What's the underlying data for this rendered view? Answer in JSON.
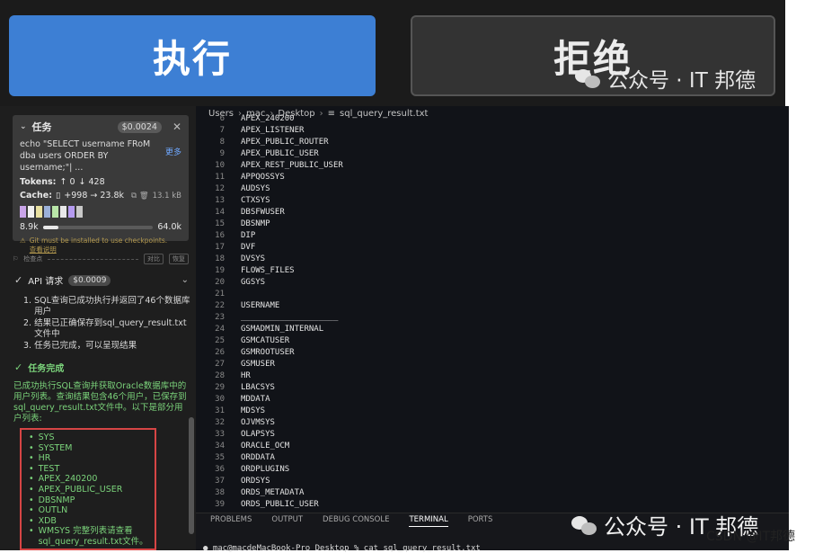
{
  "buttons": {
    "run": "执行",
    "reject": "拒绝"
  },
  "watermark": {
    "text": "公众号 · IT 邦德"
  },
  "credit": "CSDN @IT邦德",
  "task": {
    "label": "任务",
    "cost": "$0.0024",
    "command": "echo \"SELECT username FRoM dba users ORDER BY username;\"| ...",
    "more": "更多",
    "tokens_label": "Tokens:",
    "tokens_up": "↑ 0",
    "tokens_down": "↓ 428",
    "cache_label": "Cache:",
    "cache_value": "+998 → 23.8k",
    "size": "13.1 kB",
    "context_left": "8.9k",
    "context_right": "64.0k",
    "context_fraction": 0.14,
    "warning": "Git must be installed to use checkpoints.",
    "warning_link": "查看说明",
    "swatch_colors": [
      "#c9a4e8",
      "#f0f0f0",
      "#e8e0a0",
      "#9bb0d8",
      "#b9e6a8",
      "#e8e8e8",
      "#b59bf0",
      "#c8c8c8"
    ]
  },
  "mini_bar": {
    "left": "检查点",
    "b1": "对比",
    "b2": "恢复"
  },
  "api": {
    "label": "API 请求",
    "cost": "$0.0009",
    "steps": [
      {
        "n": "1.",
        "text": "SQL查询已成功执行并返回了46个数据库用户"
      },
      {
        "n": "2.",
        "text": "结果已正确保存到sql_query_result.txt文件中"
      },
      {
        "n": "3.",
        "text": "任务已完成，可以呈现结果"
      }
    ]
  },
  "done": {
    "label": "任务完成",
    "summary": "已成功执行SQL查询并获取Oracle数据库中的用户列表。查询结果包含46个用户，已保存到sql_query_result.txt文件中。以下是部分用户列表:"
  },
  "users": [
    "SYS",
    "SYSTEM",
    "HR",
    "TEST",
    "APEX_240200",
    "APEX_PUBLIC_USER",
    "DBSNMP",
    "OUTLN",
    "XDB",
    "WMSYS 完整列表请查看sql_query_result.txt文件。"
  ],
  "breadcrumb": {
    "p1": "Users",
    "p2": "mac",
    "p3": "Desktop",
    "file": "sql_query_result.txt"
  },
  "code_lines": [
    {
      "n": "6",
      "t": "APEX_240200"
    },
    {
      "n": "7",
      "t": "APEX_LISTENER"
    },
    {
      "n": "8",
      "t": "APEX_PUBLIC_ROUTER"
    },
    {
      "n": "9",
      "t": "APEX_PUBLIC_USER"
    },
    {
      "n": "10",
      "t": "APEX_REST_PUBLIC_USER"
    },
    {
      "n": "11",
      "t": "APPQOSSYS"
    },
    {
      "n": "12",
      "t": "AUDSYS"
    },
    {
      "n": "13",
      "t": "CTXSYS"
    },
    {
      "n": "14",
      "t": "DBSFWUSER"
    },
    {
      "n": "15",
      "t": "DBSNMP"
    },
    {
      "n": "16",
      "t": "DIP"
    },
    {
      "n": "17",
      "t": "DVF"
    },
    {
      "n": "18",
      "t": "DVSYS"
    },
    {
      "n": "19",
      "t": "FLOWS_FILES"
    },
    {
      "n": "20",
      "t": "GGSYS"
    },
    {
      "n": "21",
      "t": ""
    },
    {
      "n": "22",
      "t": "USERNAME"
    },
    {
      "n": "23",
      "t": "____________________"
    },
    {
      "n": "24",
      "t": "GSMADMIN_INTERNAL"
    },
    {
      "n": "25",
      "t": "GSMCATUSER"
    },
    {
      "n": "26",
      "t": "GSMROOTUSER"
    },
    {
      "n": "27",
      "t": "GSMUSER"
    },
    {
      "n": "28",
      "t": "HR"
    },
    {
      "n": "29",
      "t": "LBACSYS"
    },
    {
      "n": "30",
      "t": "MDDATA"
    },
    {
      "n": "31",
      "t": "MDSYS"
    },
    {
      "n": "32",
      "t": "OJVMSYS"
    },
    {
      "n": "33",
      "t": "OLAPSYS"
    },
    {
      "n": "34",
      "t": "ORACLE_OCM"
    },
    {
      "n": "35",
      "t": "ORDDATA"
    },
    {
      "n": "36",
      "t": "ORDPLUGINS"
    },
    {
      "n": "37",
      "t": "ORDSYS"
    },
    {
      "n": "38",
      "t": "ORDS_METADATA"
    },
    {
      "n": "39",
      "t": "ORDS_PUBLIC_USER"
    }
  ],
  "terminal": {
    "tabs": [
      "PROBLEMS",
      "OUTPUT",
      "DEBUG CONSOLE",
      "TERMINAL",
      "PORTS"
    ],
    "active_tab": "TERMINAL",
    "prompt": "● mac@macdeMacBook-Pro Desktop % cat sql_query_result.txt"
  }
}
